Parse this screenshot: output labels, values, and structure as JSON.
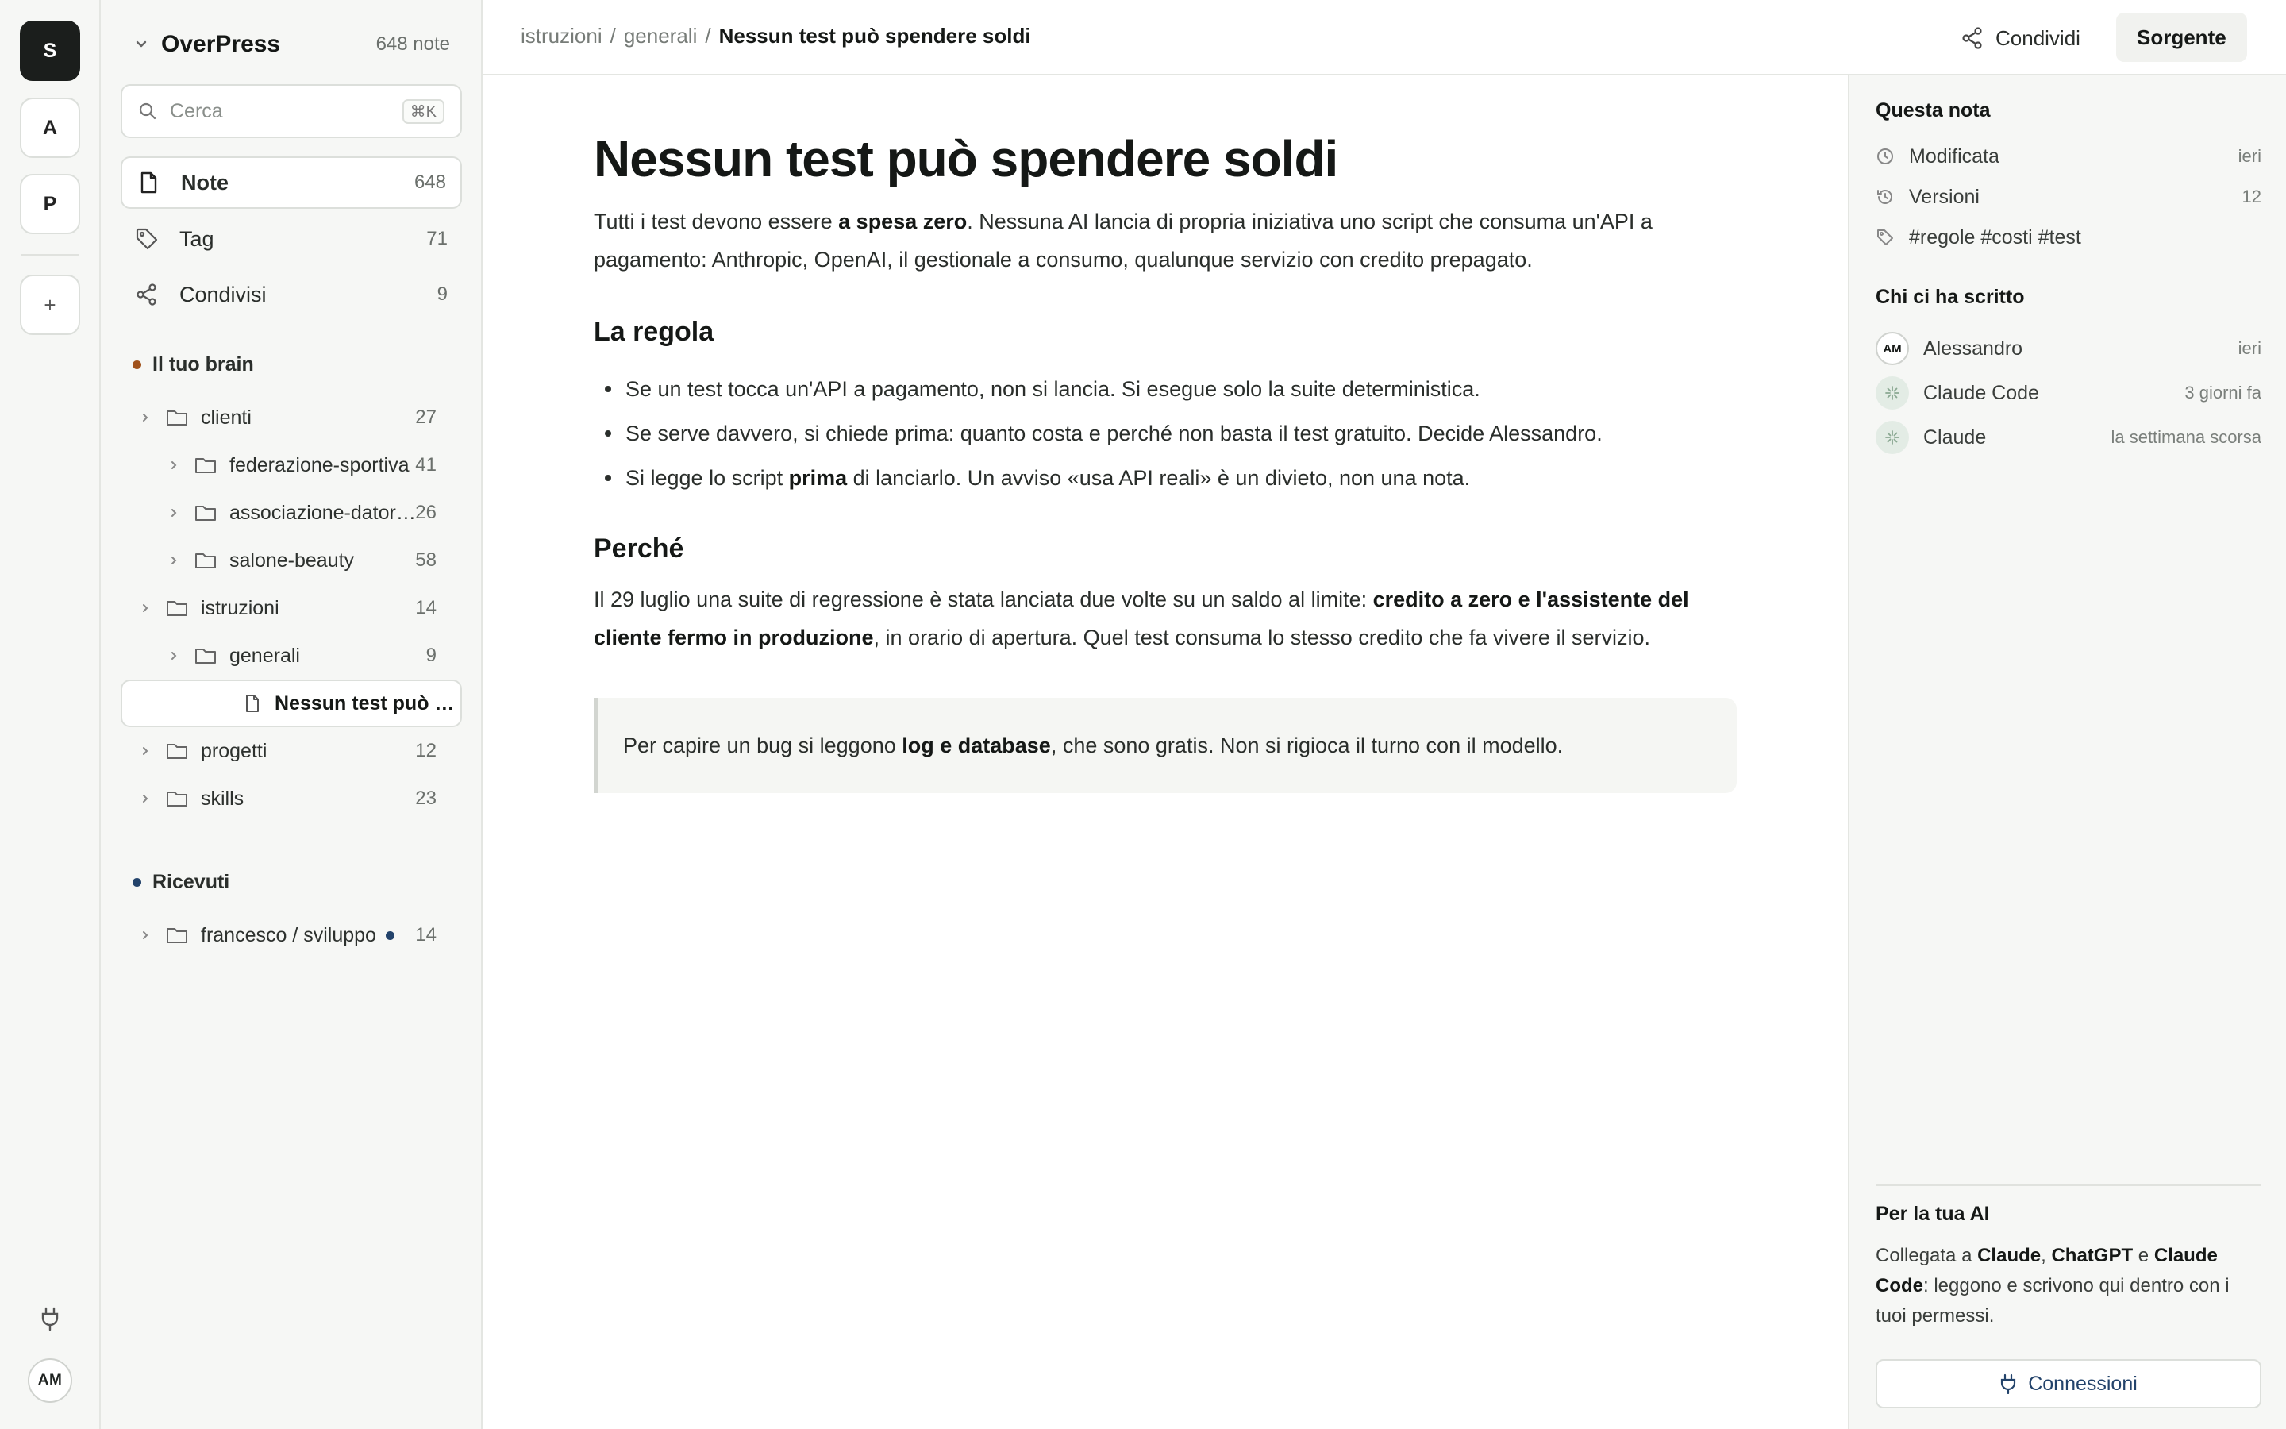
{
  "rail": {
    "workspaces": [
      {
        "letter": "S",
        "active": true
      },
      {
        "letter": "A",
        "active": false
      },
      {
        "letter": "P",
        "active": false
      }
    ],
    "add_label": "+",
    "user_initials": "AM"
  },
  "sidebar": {
    "title": "OverPress",
    "count": "648 note",
    "search": {
      "placeholder": "Cerca",
      "shortcut": "⌘K"
    },
    "nav": [
      {
        "label": "Note",
        "count": "648",
        "icon": "file-icon"
      },
      {
        "label": "Tag",
        "count": "71",
        "icon": "tag-icon"
      },
      {
        "label": "Condivisi",
        "count": "9",
        "icon": "share-icon"
      }
    ],
    "brain_section": {
      "label": "Il tuo brain",
      "dot_color": "#a0521b"
    },
    "tree": [
      {
        "label": "clienti",
        "count": "27",
        "level": 0
      },
      {
        "label": "federazione-sportiva",
        "count": "41",
        "level": 1
      },
      {
        "label": "associazione-datori…",
        "count": "26",
        "level": 1
      },
      {
        "label": "salone-beauty",
        "count": "58",
        "level": 1
      },
      {
        "label": "istruzioni",
        "count": "14",
        "level": 0
      },
      {
        "label": "generali",
        "count": "9",
        "level": 1
      },
      {
        "label": "Nessun test può s…",
        "count": "",
        "level": 2,
        "current": true
      },
      {
        "label": "progetti",
        "count": "12",
        "level": 0
      },
      {
        "label": "skills",
        "count": "23",
        "level": 0
      }
    ],
    "received_section": {
      "label": "Ricevuti",
      "dot_color": "#23436b"
    },
    "received": [
      {
        "label": "francesco / sviluppo",
        "count": "14",
        "unread": true
      }
    ]
  },
  "topbar": {
    "breadcrumb": [
      "istruzioni",
      "/",
      "generali",
      "/"
    ],
    "current": "Nessun test può spendere soldi",
    "share_label": "Condividi",
    "source_label": "Sorgente"
  },
  "doc": {
    "title": "Nessun test può spendere soldi",
    "intro": {
      "before": "Tutti i test devono essere ",
      "bold": "a spesa zero",
      "after": ". Nessuna AI lancia di propria iniziativa uno script che consuma un'API a pagamento: Anthropic, OpenAI, il gestionale a consumo, qualunque servizio con credito prepagato."
    },
    "rule_heading": "La regola",
    "rules": [
      {
        "before": "Se un test tocca un'API a pagamento, non si lancia. Si esegue solo la suite deterministica.",
        "bold": "",
        "after": ""
      },
      {
        "before": "Se serve davvero, si chiede prima: quanto costa e perché non basta il test gratuito. Decide Alessandro.",
        "bold": "",
        "after": ""
      },
      {
        "before": "Si legge lo script ",
        "bold": "prima",
        "after": " di lanciarlo. Un avviso «usa API reali» è un divieto, non una nota."
      }
    ],
    "why_heading": "Perché",
    "why": {
      "before": "Il 29 luglio una suite di regressione è stata lanciata due volte su un saldo al limite: ",
      "bold": "credito a zero e l'assistente del cliente fermo in produzione",
      "after": ", in orario di apertura. Quel test consuma lo stesso credito che fa vivere il servizio."
    },
    "callout": {
      "before": "Per capire un bug si leggono ",
      "bold": "log e database",
      "after": ", che sono gratis. Non si rigioca il turno con il modello."
    }
  },
  "right_panel": {
    "note_heading": "Questa nota",
    "note_meta": [
      {
        "label": "Modificata",
        "value": "ieri",
        "icon": "clock-icon"
      },
      {
        "label": "Versioni",
        "value": "12",
        "icon": "history-icon"
      },
      {
        "label": "#regole #costi #test",
        "value": "",
        "icon": "tag-icon"
      }
    ],
    "authors_heading": "Chi ci ha scritto",
    "authors": [
      {
        "name": "Alessandro",
        "when": "ieri",
        "avatar": "AM",
        "kind": "user"
      },
      {
        "name": "Claude Code",
        "when": "3 giorni fa",
        "avatar": "",
        "kind": "bot"
      },
      {
        "name": "Claude",
        "when": "la settimana scorsa",
        "avatar": "",
        "kind": "bot"
      }
    ],
    "ai_heading": "Per la tua AI",
    "ai_text": {
      "t1": "Collegata a ",
      "b1": "Claude",
      "t2": ", ",
      "b2": "ChatGPT",
      "t3": " e ",
      "b3": "Claude Code",
      "t4": ": leggono e scrivono qui dentro con i tuoi permessi."
    },
    "connections_label": "Connessioni"
  },
  "colors": {
    "accent_blue": "#23436b",
    "brain_dot": "#a0521b",
    "active_workspace": "#1b1e1c"
  }
}
